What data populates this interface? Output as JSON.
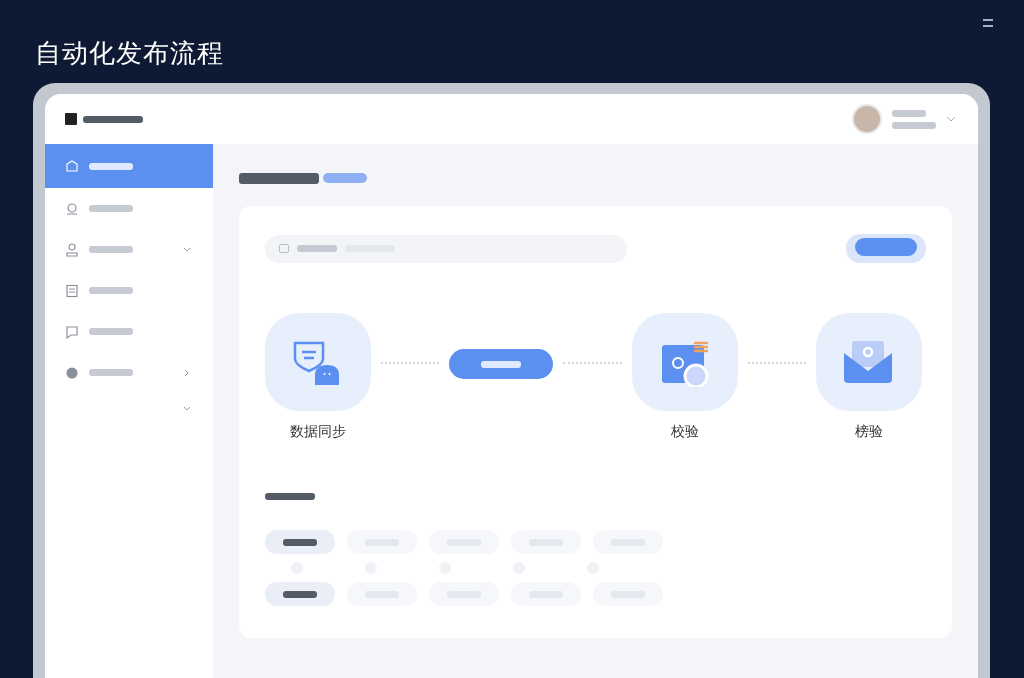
{
  "slide_title": "自动化发布流程",
  "sidebar": {
    "items": [
      {
        "selected": true
      },
      {
        "selected": false
      },
      {
        "selected": false,
        "expanded": true
      },
      {
        "selected": false
      },
      {
        "selected": false
      },
      {
        "selected": false,
        "expanded": false
      }
    ]
  },
  "flow": {
    "steps": [
      {
        "kind": "node",
        "label": "数据同步"
      },
      {
        "kind": "pill"
      },
      {
        "kind": "node",
        "label": "校验"
      },
      {
        "kind": "node",
        "label": "榜验"
      }
    ]
  },
  "chips": [
    [
      {
        "selected": true
      },
      {
        "selected": false
      },
      {
        "selected": false
      },
      {
        "selected": false
      },
      {
        "selected": false
      }
    ],
    [
      {
        "selected": true
      },
      {
        "selected": false
      },
      {
        "selected": false
      },
      {
        "selected": false
      },
      {
        "selected": false
      }
    ]
  ]
}
